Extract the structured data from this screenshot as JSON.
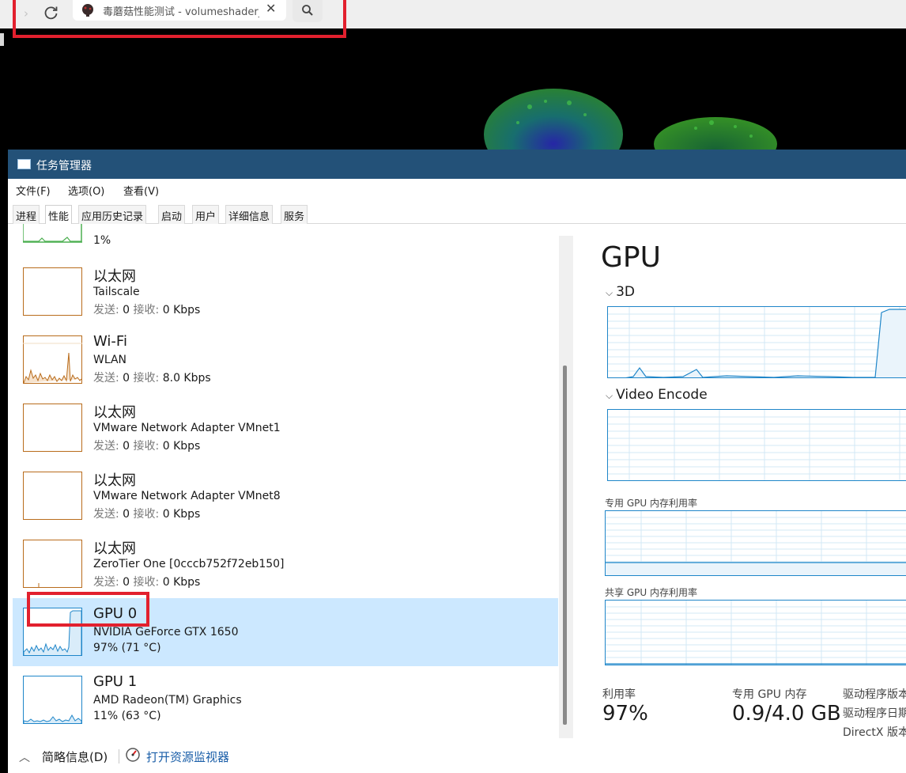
{
  "browser": {
    "tab_title": "毒蘑菇性能测试 - volumeshader_bm",
    "tab_close": "✕",
    "forward_glyph": "›"
  },
  "taskmanager": {
    "title": "任务管理器",
    "menu": [
      {
        "label": "文件(F)"
      },
      {
        "label": "选项(O)"
      },
      {
        "label": "查看(V)"
      }
    ],
    "tabs": [
      {
        "label": "进程"
      },
      {
        "label": "性能"
      },
      {
        "label": "应用历史记录"
      },
      {
        "label": "启动"
      },
      {
        "label": "用户"
      },
      {
        "label": "详细信息"
      },
      {
        "label": "服务"
      }
    ],
    "active_tab": "性能",
    "partial_row_value": "1%",
    "devices": [
      {
        "name": "以太网",
        "sub": "Tailscale",
        "send_label": "发送:",
        "send_value": "0",
        "recv_label": "接收:",
        "recv_value": "0 Kbps",
        "color": "#b96c1c"
      },
      {
        "name": "Wi-Fi",
        "sub": "WLAN",
        "send_label": "发送:",
        "send_value": "0",
        "recv_label": "接收:",
        "recv_value": "8.0 Kbps",
        "color": "#b96c1c"
      },
      {
        "name": "以太网",
        "sub": "VMware Network Adapter VMnet1",
        "send_label": "发送:",
        "send_value": "0",
        "recv_label": "接收:",
        "recv_value": "0 Kbps",
        "color": "#b96c1c"
      },
      {
        "name": "以太网",
        "sub": "VMware Network Adapter VMnet8",
        "send_label": "发送:",
        "send_value": "0",
        "recv_label": "接收:",
        "recv_value": "0 Kbps",
        "color": "#b96c1c"
      },
      {
        "name": "以太网",
        "sub": "ZeroTier One [0cccb752f72eb150]",
        "send_label": "发送:",
        "send_value": "0",
        "recv_label": "接收:",
        "recv_value": "0 Kbps",
        "color": "#b96c1c"
      },
      {
        "name": "GPU 0",
        "sub": "NVIDIA GeForce GTX 1650",
        "stat": "97% (71 °C)",
        "color": "#1f86c9",
        "selected": true
      },
      {
        "name": "GPU 1",
        "sub": "AMD Radeon(TM) Graphics",
        "stat": "11% (63 °C)",
        "color": "#1f86c9"
      }
    ],
    "detail": {
      "title": "GPU",
      "graph_3d_label": "3D",
      "graph_encode_label": "Video Encode",
      "dedicated_mem_graph_label": "专用 GPU 内存利用率",
      "shared_mem_graph_label": "共享 GPU 内存利用率",
      "utilization_label": "利用率",
      "utilization_value": "97%",
      "dedicated_mem_label": "专用 GPU 内存",
      "dedicated_mem_value": "0.9/4.0 GB",
      "driver_version_label": "驱动程序版本:",
      "driver_date_label": "驱动程序日期:",
      "directx_label": "DirectX 版本:"
    },
    "bottom": {
      "fewer_details": "简略信息(D)",
      "open_monitor": "打开资源监视器"
    }
  },
  "colors": {
    "titlebar": "#235178",
    "selection": "#cce8ff",
    "gpu_line": "#1f86c9",
    "net_line": "#b96c1c",
    "cpu_line": "#4caf50",
    "annotation": "#e2202e"
  }
}
